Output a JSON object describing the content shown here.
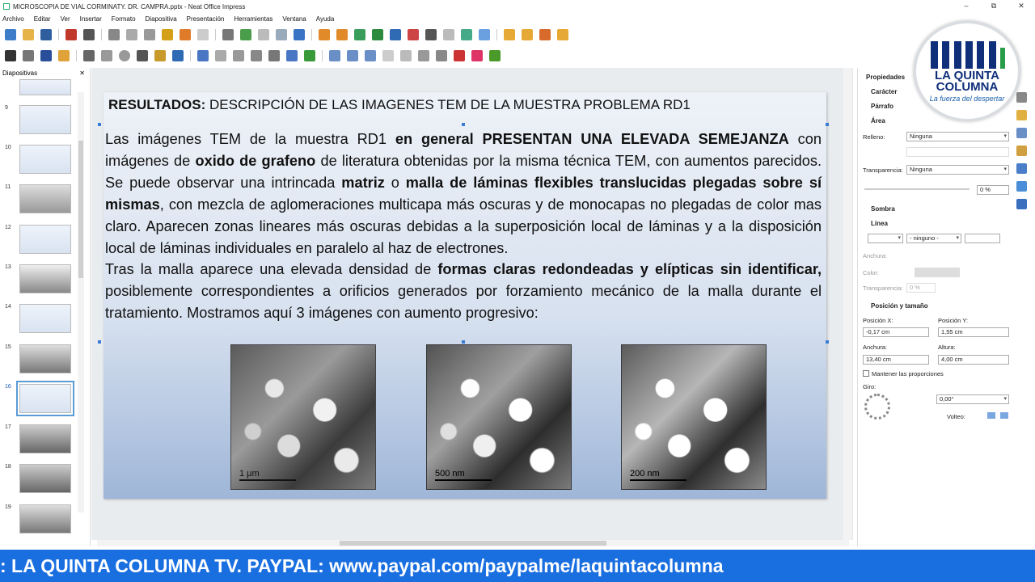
{
  "window": {
    "title": "MICROSCOPIA DE VIAL CORMINATY. DR. CAMPRA.pptx - Neat Office Impress",
    "controls": [
      "–",
      "⧉",
      "✕"
    ]
  },
  "menu": [
    "Archivo",
    "Editar",
    "Ver",
    "Insertar",
    "Formato",
    "Diapositiva",
    "Presentación",
    "Herramientas",
    "Ventana",
    "Ayuda"
  ],
  "slide_panel": {
    "title": "Diapositivas",
    "close": "✕",
    "numbers": [
      "9",
      "10",
      "11",
      "12",
      "13",
      "14",
      "15",
      "16",
      "17",
      "18",
      "19"
    ],
    "selected": "16"
  },
  "slide": {
    "title_bold": "RESULTADOS:",
    "title_rest": " DESCRIPCIÓN DE LAS IMAGENES TEM DE LA MUESTRA PROBLEMA RD1",
    "p1": "Las imágenes TEM de la muestra RD1 ",
    "p1b": "en general PRESENTAN UNA ELEVADA SEMEJANZA",
    "p2": " con imágenes de ",
    "p2b": "oxido de grafeno",
    "p3": " de literatura obtenidas por la misma técnica TEM, con aumentos parecidos. Se puede observar una intrincada ",
    "p3b": "matriz",
    "p4": " o ",
    "p4b": "malla de láminas flexibles translucidas plegadas sobre sí mismas",
    "p5": ", con mezcla de aglomeraciones multicapa más oscuras y de monocapas no plegadas de color mas claro. Aparecen zonas lineares más oscuras debidas a la superposición local de láminas y a la disposición local de láminas individuales en paralelo al haz de electrones.",
    "p6": "Tras la malla aparece una elevada densidad de ",
    "p6b": "formas claras redondeadas y elípticas sin identificar,",
    "p7": " posiblemente correspondientes a orificios generados por forzamiento mecánico de la malla durante el tratamiento. Mostramos aquí 3 imágenes con aumento progresivo:",
    "images": [
      {
        "scale": "1 µm"
      },
      {
        "scale": "500 nm"
      },
      {
        "scale": "200 nm"
      }
    ]
  },
  "properties": {
    "title": "Propiedades",
    "sections": {
      "caracter": "Carácter",
      "parrafo": "Párrafo",
      "area": "Área",
      "sombra": "Sombra",
      "linea": "Línea",
      "posicion": "Posición y tamaño"
    },
    "relleno_label": "Relleno:",
    "relleno_value": "Ninguna",
    "transparencia_label": "Transparencia:",
    "transparencia_value": "Ninguna",
    "transparencia_pct": "0 %",
    "linea_style": "- ninguno -",
    "anchura_label": "Anchura:",
    "color_label": "Color:",
    "line_transp_label": "Transparencia:",
    "line_transp_value": "0 %",
    "pos_x_label": "Posición X:",
    "pos_x_value": "-0,17 cm",
    "pos_y_label": "Posición Y:",
    "pos_y_value": "1,55 cm",
    "width_label": "Anchura:",
    "width_value": "13,40 cm",
    "height_label": "Altura:",
    "height_value": "4,00 cm",
    "keep_ratio": "Mantener las proporciones",
    "giro_label": "Giro:",
    "giro_value": "0,00°",
    "volteo_label": "Volteo:"
  },
  "logo": {
    "line1": "LA QUINTA",
    "line2": "COLUMNA",
    "tagline": "La fuerza del despertar"
  },
  "ticker": ": LA QUINTA COLUMNA TV. PAYPAL: www.paypal.com/paypalme/laquintacolumna",
  "colors": {
    "ticker_bg": "#1a6fe0",
    "logo_blue": "#0f2f7a",
    "logo_green": "#2a9d4a",
    "selection_handle": "#3a7bd5"
  }
}
